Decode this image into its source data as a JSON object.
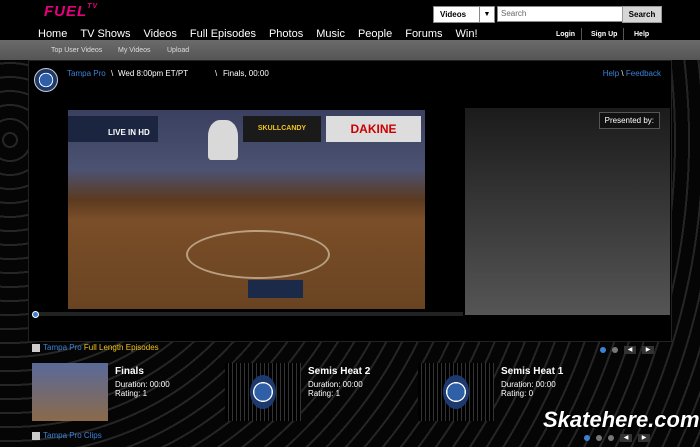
{
  "header": {
    "logo": "FUEL",
    "logo_tv": "TV",
    "nav": [
      "Home",
      "TV Shows",
      "Videos",
      "Full Episodes",
      "Photos",
      "Music",
      "People",
      "Forums",
      "Win!"
    ],
    "search": {
      "scope": "Videos",
      "placeholder": "Search",
      "button": "Search"
    },
    "account": {
      "login": "Login",
      "signup": "Sign Up",
      "help": "Help"
    }
  },
  "subnav": [
    "Top User Videos",
    "My Videos",
    "Upload"
  ],
  "player": {
    "show": "Tampa Pro",
    "airtime": "Wed 8:00pm ET/PT",
    "episode": "Finals, 00:00",
    "sep": "\\",
    "help": "Help",
    "feedback": "Feedback",
    "presented": "Presented by:",
    "overlay": "LIVE IN HD",
    "banners": [
      "SKULLCANDY",
      "DAKINE"
    ]
  },
  "episodes_section": {
    "show": "Tampa Pro",
    "label": "Full Length Episodes"
  },
  "episodes": [
    {
      "title": "Finals",
      "duration": "Duration: 00:00",
      "rating": "Rating: 1"
    },
    {
      "title": "Semis Heat 2",
      "duration": "Duration: 00:00",
      "rating": "Rating: 1"
    },
    {
      "title": "Semis Heat 1",
      "duration": "Duration: 00:00",
      "rating": "Rating: 0"
    }
  ],
  "clips_section": {
    "show": "Tampa Pro",
    "label": "Clips"
  },
  "watermark": "Skatehere.com",
  "colors": {
    "brand": "#e6007e",
    "link": "#3b82d6",
    "highlight": "#f0c419"
  }
}
